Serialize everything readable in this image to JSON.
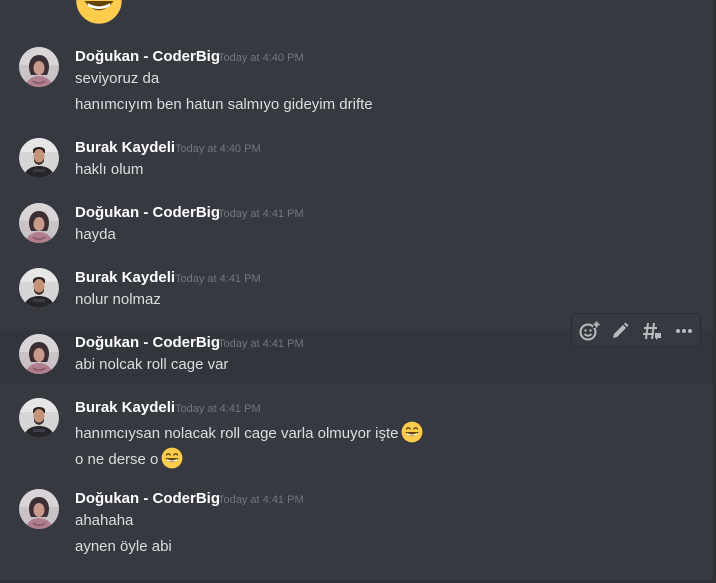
{
  "users": {
    "dogukan": "Doğukan - CoderBig",
    "burak": "Burak Kaydeli"
  },
  "messages": [
    {
      "author": "Doğukan - CoderBig",
      "time": "Today at 4:40 PM",
      "lines": [
        "seviyoruz da",
        "hanımcıyım ben hatun salmıyo gideyim drifte"
      ]
    },
    {
      "author": "Burak Kaydeli",
      "time": "Today at 4:40 PM",
      "lines": [
        "haklı olum"
      ]
    },
    {
      "author": "Doğukan - CoderBig",
      "time": "Today at 4:41 PM",
      "lines": [
        "hayda"
      ]
    },
    {
      "author": "Burak Kaydeli",
      "time": "Today at 4:41 PM",
      "lines": [
        "nolur nolmaz"
      ]
    },
    {
      "author": "Doğukan - CoderBig",
      "time": "Today at 4:41 PM",
      "lines": [
        "abi nolcak roll cage var"
      ]
    },
    {
      "author": "Burak Kaydeli",
      "time": "Today at 4:41 PM",
      "lines": [
        "hanımcıysan nolacak roll cage varla olmuyor işte",
        "o ne derse o"
      ]
    },
    {
      "author": "Doğukan - CoderBig",
      "time": "Today at 4:41 PM",
      "lines": [
        "ahahaha",
        "aynen öyle abi"
      ]
    }
  ],
  "toolbar": {
    "icons": [
      "add-reaction-icon",
      "edit-icon",
      "create-thread-icon",
      "more-options-icon"
    ]
  },
  "colors": {
    "background": "#36393f",
    "hover_background": "#32353b",
    "username": "#ffffff",
    "text": "#dcddde",
    "timestamp": "#72767d",
    "toolbar_icon": "#b9bbbe",
    "emoji": "#f9c42f"
  }
}
